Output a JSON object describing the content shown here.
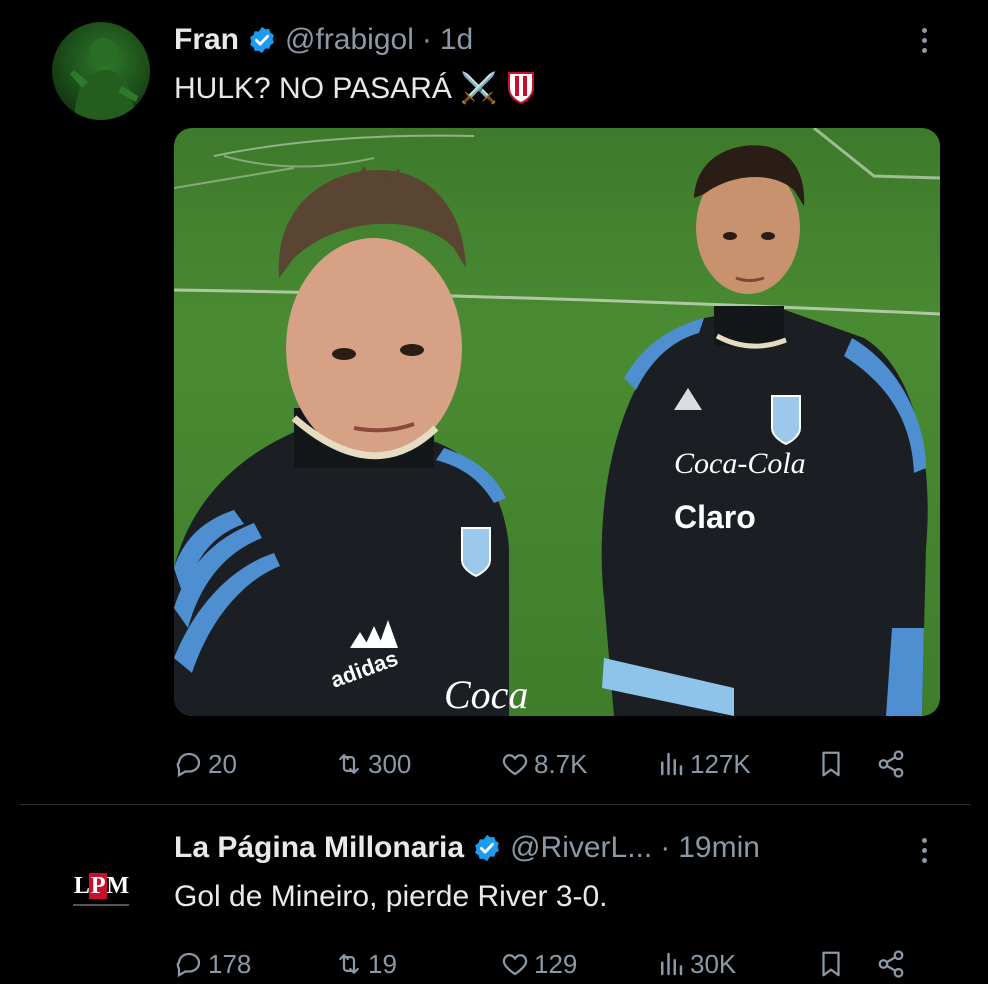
{
  "tweet1": {
    "name": "Fran",
    "handle": "@frabigol",
    "dot": "·",
    "time": "1d",
    "text": "HULK? NO PASARÁ ⚔️",
    "actions": {
      "replies": "20",
      "retweets": "300",
      "likes": "8.7K",
      "views": "127K"
    },
    "media": {
      "left_shirt_text": "Coca-Cola",
      "right_sponsor_1": "Coca-Cola",
      "right_sponsor_2": "Claro",
      "brand": "adidas"
    }
  },
  "tweet2": {
    "name": "La Página Millonaria",
    "handle": "@RiverL...",
    "dot": "·",
    "time": "19min",
    "text": "Gol de Mineiro, pierde River 3-0.",
    "logo_text_left": "L",
    "logo_text_mid": "P",
    "logo_text_right": "M",
    "actions": {
      "replies": "178",
      "retweets": "19",
      "likes": "129",
      "views": "30K"
    }
  },
  "colors": {
    "verified": "#1d9bf0",
    "background": "#000000",
    "muted": "#8b98a5",
    "text": "#e7e9ea"
  },
  "icons": [
    "verified-badge-icon",
    "more-icon",
    "reply-icon",
    "retweet-icon",
    "like-icon",
    "views-icon",
    "bookmark-icon",
    "share-icon"
  ]
}
